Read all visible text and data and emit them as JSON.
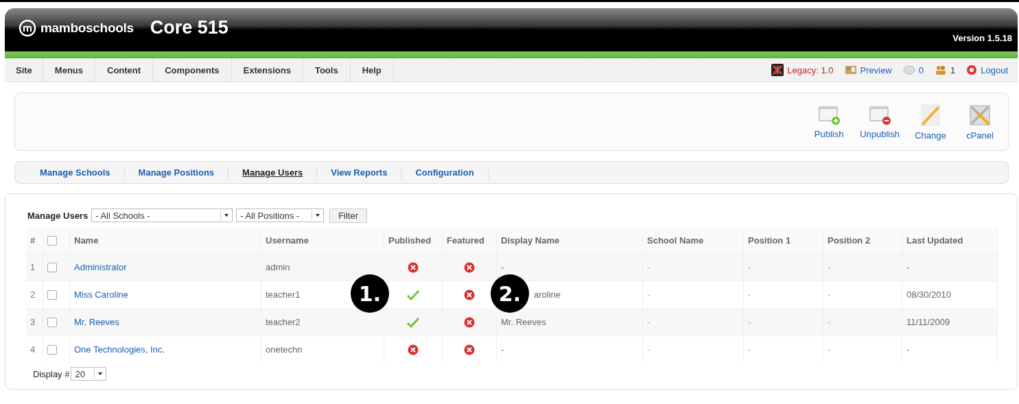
{
  "header": {
    "logo": "mamboschools",
    "title": "Core 515",
    "version": "Version 1.5.18"
  },
  "menu": [
    {
      "label": "Site"
    },
    {
      "label": "Menus"
    },
    {
      "label": "Content"
    },
    {
      "label": "Components"
    },
    {
      "label": "Extensions"
    },
    {
      "label": "Tools"
    },
    {
      "label": "Help"
    }
  ],
  "status": [
    {
      "kind": "legacy",
      "label": "Legacy: 1.0"
    },
    {
      "kind": "preview",
      "label": "Preview"
    },
    {
      "kind": "messages",
      "label": "0"
    },
    {
      "kind": "users",
      "label": "1"
    },
    {
      "kind": "logout",
      "label": "Logout"
    }
  ],
  "toolbar": [
    {
      "kind": "publish",
      "label": "Publish"
    },
    {
      "kind": "unpublish",
      "label": "Unpublish"
    },
    {
      "kind": "change",
      "label": "Change"
    },
    {
      "kind": "cpanel",
      "label": "cPanel"
    }
  ],
  "subtabs": [
    {
      "label": "Manage Schools",
      "selected": false
    },
    {
      "label": "Manage Positions",
      "selected": false
    },
    {
      "label": "Manage Users",
      "selected": true
    },
    {
      "label": "View Reports",
      "selected": false
    },
    {
      "label": "Configuration",
      "selected": false
    }
  ],
  "filter": {
    "label": "Manage Users",
    "school": "- All Schools -",
    "position": "- All Positions -",
    "button": "Filter"
  },
  "table": {
    "select_all_checked": false,
    "columns": [
      "#",
      "Name",
      "Username",
      "Published",
      "Featured",
      "Display Name",
      "School Name",
      "Position 1",
      "Position 2",
      "Last Updated"
    ],
    "rows": [
      {
        "num": "1",
        "checked": false,
        "name": "Administrator",
        "username": "admin",
        "published": false,
        "featured": false,
        "display_name": "-",
        "school": "-",
        "position_1": "-",
        "position_2": "-",
        "updated": "-"
      },
      {
        "num": "2",
        "checked": false,
        "name": "Miss Caroline",
        "username": "teacher1",
        "published": true,
        "featured": false,
        "display_name": "aroline",
        "school": "-",
        "position_1": "-",
        "position_2": "-",
        "updated": "08/30/2010"
      },
      {
        "num": "3",
        "checked": false,
        "name": "Mr. Reeves",
        "username": "teacher2",
        "published": true,
        "featured": false,
        "display_name": "Mr. Reeves",
        "school": "-",
        "position_1": "-",
        "position_2": "-",
        "updated": "11/11/2009"
      },
      {
        "num": "4",
        "checked": false,
        "name": "One Technologies, Inc.",
        "username": "onetechn",
        "published": false,
        "featured": false,
        "display_name": "-",
        "school": "-",
        "position_1": "-",
        "position_2": "-",
        "updated": "-"
      }
    ]
  },
  "display": {
    "label": "Display #",
    "value": "20"
  },
  "callouts": [
    {
      "label": "1."
    },
    {
      "label": "2."
    }
  ]
}
